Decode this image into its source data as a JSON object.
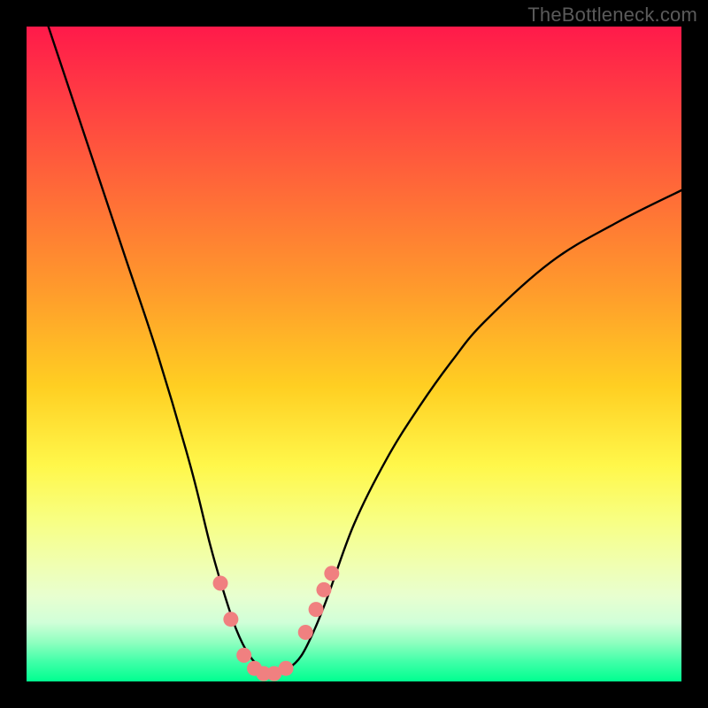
{
  "watermark": {
    "text": "TheBottleneck.com"
  },
  "chart_data": {
    "type": "line",
    "title": "",
    "xlabel": "",
    "ylabel": "",
    "series": [
      {
        "name": "bottleneck-curve",
        "x": [
          0.0,
          0.05,
          0.1,
          0.15,
          0.2,
          0.25,
          0.28,
          0.3,
          0.32,
          0.34,
          0.36,
          0.38,
          0.4,
          0.42,
          0.44,
          0.46,
          0.5,
          0.55,
          0.6,
          0.65,
          0.7,
          0.8,
          0.9,
          1.0
        ],
        "y": [
          1.1,
          0.95,
          0.8,
          0.65,
          0.5,
          0.33,
          0.21,
          0.14,
          0.08,
          0.04,
          0.02,
          0.01,
          0.02,
          0.04,
          0.08,
          0.13,
          0.24,
          0.34,
          0.42,
          0.49,
          0.55,
          0.64,
          0.7,
          0.75
        ]
      }
    ],
    "markers": {
      "name": "highlighted-points",
      "color": "#f08080",
      "x": [
        0.296,
        0.312,
        0.332,
        0.348,
        0.362,
        0.378,
        0.396,
        0.426,
        0.442,
        0.454,
        0.466
      ],
      "y": [
        0.15,
        0.095,
        0.04,
        0.02,
        0.012,
        0.012,
        0.02,
        0.075,
        0.11,
        0.14,
        0.165
      ]
    },
    "xlim": [
      0,
      1
    ],
    "ylim": [
      0,
      1
    ],
    "grid": false,
    "legend": false
  }
}
